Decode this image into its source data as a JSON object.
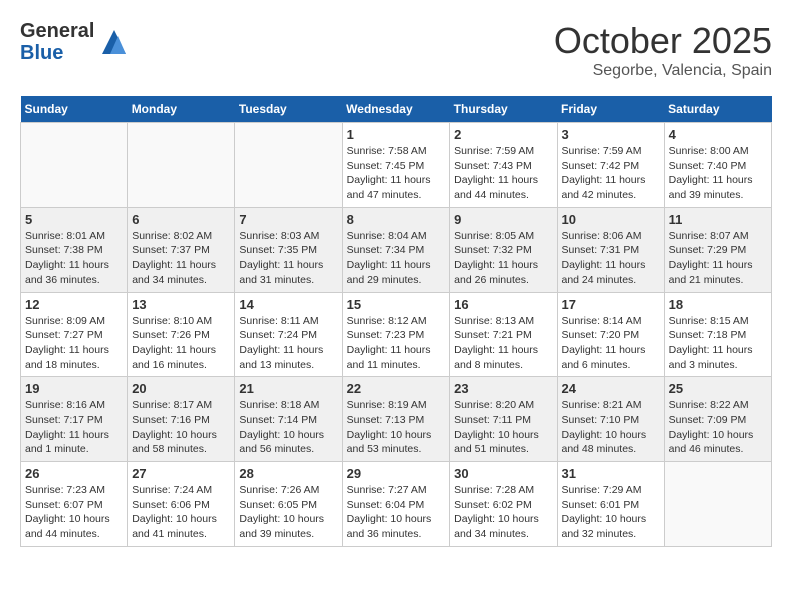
{
  "header": {
    "logo_general": "General",
    "logo_blue": "Blue",
    "month_title": "October 2025",
    "location": "Segorbe, Valencia, Spain"
  },
  "weekdays": [
    "Sunday",
    "Monday",
    "Tuesday",
    "Wednesday",
    "Thursday",
    "Friday",
    "Saturday"
  ],
  "weeks": [
    [
      {
        "day": "",
        "info": ""
      },
      {
        "day": "",
        "info": ""
      },
      {
        "day": "",
        "info": ""
      },
      {
        "day": "1",
        "info": "Sunrise: 7:58 AM\nSunset: 7:45 PM\nDaylight: 11 hours and 47 minutes."
      },
      {
        "day": "2",
        "info": "Sunrise: 7:59 AM\nSunset: 7:43 PM\nDaylight: 11 hours and 44 minutes."
      },
      {
        "day": "3",
        "info": "Sunrise: 7:59 AM\nSunset: 7:42 PM\nDaylight: 11 hours and 42 minutes."
      },
      {
        "day": "4",
        "info": "Sunrise: 8:00 AM\nSunset: 7:40 PM\nDaylight: 11 hours and 39 minutes."
      }
    ],
    [
      {
        "day": "5",
        "info": "Sunrise: 8:01 AM\nSunset: 7:38 PM\nDaylight: 11 hours and 36 minutes."
      },
      {
        "day": "6",
        "info": "Sunrise: 8:02 AM\nSunset: 7:37 PM\nDaylight: 11 hours and 34 minutes."
      },
      {
        "day": "7",
        "info": "Sunrise: 8:03 AM\nSunset: 7:35 PM\nDaylight: 11 hours and 31 minutes."
      },
      {
        "day": "8",
        "info": "Sunrise: 8:04 AM\nSunset: 7:34 PM\nDaylight: 11 hours and 29 minutes."
      },
      {
        "day": "9",
        "info": "Sunrise: 8:05 AM\nSunset: 7:32 PM\nDaylight: 11 hours and 26 minutes."
      },
      {
        "day": "10",
        "info": "Sunrise: 8:06 AM\nSunset: 7:31 PM\nDaylight: 11 hours and 24 minutes."
      },
      {
        "day": "11",
        "info": "Sunrise: 8:07 AM\nSunset: 7:29 PM\nDaylight: 11 hours and 21 minutes."
      }
    ],
    [
      {
        "day": "12",
        "info": "Sunrise: 8:09 AM\nSunset: 7:27 PM\nDaylight: 11 hours and 18 minutes."
      },
      {
        "day": "13",
        "info": "Sunrise: 8:10 AM\nSunset: 7:26 PM\nDaylight: 11 hours and 16 minutes."
      },
      {
        "day": "14",
        "info": "Sunrise: 8:11 AM\nSunset: 7:24 PM\nDaylight: 11 hours and 13 minutes."
      },
      {
        "day": "15",
        "info": "Sunrise: 8:12 AM\nSunset: 7:23 PM\nDaylight: 11 hours and 11 minutes."
      },
      {
        "day": "16",
        "info": "Sunrise: 8:13 AM\nSunset: 7:21 PM\nDaylight: 11 hours and 8 minutes."
      },
      {
        "day": "17",
        "info": "Sunrise: 8:14 AM\nSunset: 7:20 PM\nDaylight: 11 hours and 6 minutes."
      },
      {
        "day": "18",
        "info": "Sunrise: 8:15 AM\nSunset: 7:18 PM\nDaylight: 11 hours and 3 minutes."
      }
    ],
    [
      {
        "day": "19",
        "info": "Sunrise: 8:16 AM\nSunset: 7:17 PM\nDaylight: 11 hours and 1 minute."
      },
      {
        "day": "20",
        "info": "Sunrise: 8:17 AM\nSunset: 7:16 PM\nDaylight: 10 hours and 58 minutes."
      },
      {
        "day": "21",
        "info": "Sunrise: 8:18 AM\nSunset: 7:14 PM\nDaylight: 10 hours and 56 minutes."
      },
      {
        "day": "22",
        "info": "Sunrise: 8:19 AM\nSunset: 7:13 PM\nDaylight: 10 hours and 53 minutes."
      },
      {
        "day": "23",
        "info": "Sunrise: 8:20 AM\nSunset: 7:11 PM\nDaylight: 10 hours and 51 minutes."
      },
      {
        "day": "24",
        "info": "Sunrise: 8:21 AM\nSunset: 7:10 PM\nDaylight: 10 hours and 48 minutes."
      },
      {
        "day": "25",
        "info": "Sunrise: 8:22 AM\nSunset: 7:09 PM\nDaylight: 10 hours and 46 minutes."
      }
    ],
    [
      {
        "day": "26",
        "info": "Sunrise: 7:23 AM\nSunset: 6:07 PM\nDaylight: 10 hours and 44 minutes."
      },
      {
        "day": "27",
        "info": "Sunrise: 7:24 AM\nSunset: 6:06 PM\nDaylight: 10 hours and 41 minutes."
      },
      {
        "day": "28",
        "info": "Sunrise: 7:26 AM\nSunset: 6:05 PM\nDaylight: 10 hours and 39 minutes."
      },
      {
        "day": "29",
        "info": "Sunrise: 7:27 AM\nSunset: 6:04 PM\nDaylight: 10 hours and 36 minutes."
      },
      {
        "day": "30",
        "info": "Sunrise: 7:28 AM\nSunset: 6:02 PM\nDaylight: 10 hours and 34 minutes."
      },
      {
        "day": "31",
        "info": "Sunrise: 7:29 AM\nSunset: 6:01 PM\nDaylight: 10 hours and 32 minutes."
      },
      {
        "day": "",
        "info": ""
      }
    ]
  ]
}
